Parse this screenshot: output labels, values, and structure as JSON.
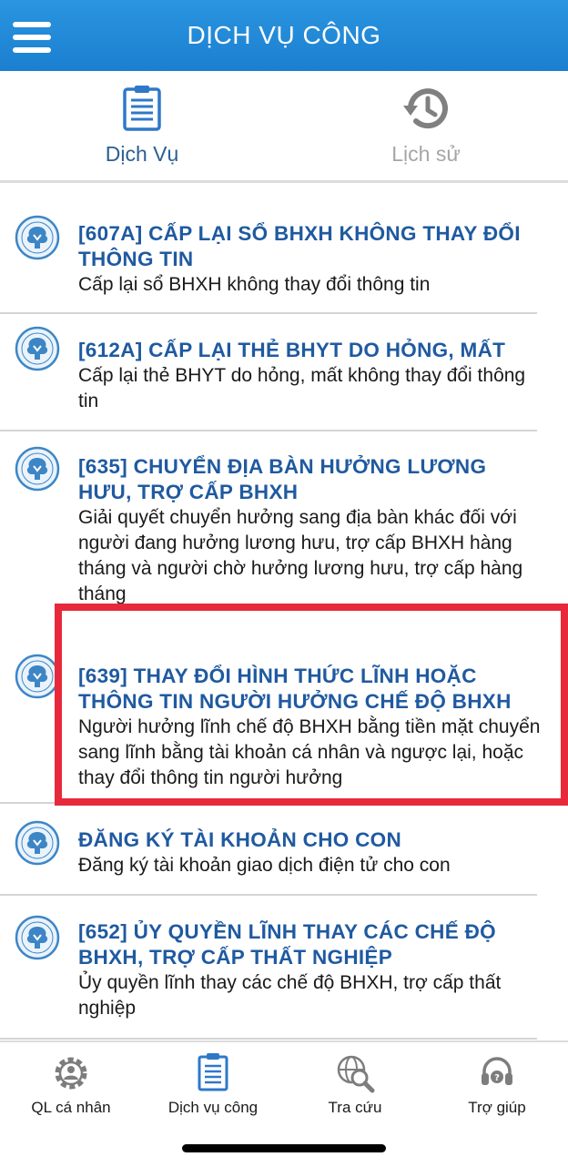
{
  "header": {
    "title": "DỊCH VỤ CÔNG",
    "menu_icon": "hamburger-menu-icon"
  },
  "tabs": [
    {
      "label": "Dịch Vụ",
      "icon": "document-list-icon",
      "active": true
    },
    {
      "label": "Lịch sử",
      "icon": "history-icon",
      "active": false
    }
  ],
  "services": [
    {
      "title": "[607A] CẤP LẠI SỔ BHXH KHÔNG THAY ĐỔI THÔNG TIN",
      "description": "Cấp lại sổ BHXH không thay đổi thông tin"
    },
    {
      "title": "[612A] CẤP LẠI THẺ BHYT DO HỎNG, MẤT",
      "description": "Cấp lại thẻ BHYT do hỏng, mất không thay đổi thông tin"
    },
    {
      "title": "[635] CHUYỂN ĐỊA BÀN HƯỞNG LƯƠNG HƯU, TRỢ CẤP BHXH",
      "description": "Giải quyết chuyển hưởng sang địa bàn khác đối với người đang hưởng lương hưu, trợ cấp BHXH hàng tháng và người chờ hưởng lương hưu, trợ cấp hàng tháng"
    },
    {
      "title": "[639] THAY ĐỔI HÌNH THỨC LĨNH HOẶC THÔNG TIN NGƯỜI HƯỞNG CHẾ ĐỘ BHXH",
      "description": "Người hưởng lĩnh chế độ BHXH bằng tiền mặt chuyển sang lĩnh bằng tài khoản cá nhân và ngược lại, hoặc thay đổi thông tin người hưởng",
      "highlighted": true
    },
    {
      "title": "ĐĂNG KÝ TÀI KHOẢN CHO CON",
      "description": "Đăng ký tài khoản giao dịch điện tử cho con"
    },
    {
      "title": "[652] ỦY QUYỀN LĨNH THAY CÁC CHẾ ĐỘ BHXH, TRỢ CẤP THẤT NGHIỆP",
      "description": "Ủy quyền lĩnh thay các chế độ BHXH, trợ cấp thất nghiệp"
    }
  ],
  "bottom_nav": [
    {
      "label": "QL cá nhân",
      "icon": "gear-person-icon"
    },
    {
      "label": "Dịch vụ công",
      "icon": "document-list-icon"
    },
    {
      "label": "Tra cứu",
      "icon": "globe-search-icon"
    },
    {
      "label": "Trợ giúp",
      "icon": "headset-help-icon"
    }
  ],
  "colors": {
    "header": "#1b7fd0",
    "title_text": "#1f5aa0",
    "highlight": "#e8293b"
  }
}
